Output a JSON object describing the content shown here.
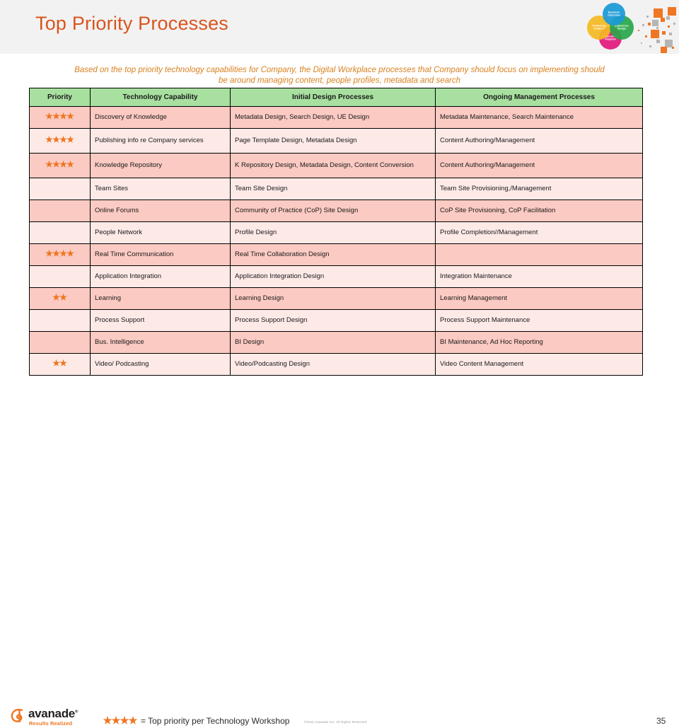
{
  "slide": {
    "title": "Top Priority Processes",
    "page_number": "35",
    "subtitle": "Based on the top priority technology capabilities for Company, the Digital Workplace processes that Company should focus on implementing should be around managing content, people profiles, metadata and search"
  },
  "corner_logo": {
    "name": "four-circle-venn-logo",
    "circles": [
      {
        "label": "Business\nOutcomes",
        "color": "#1a9ad7"
      },
      {
        "label": "Technology\nEnablers",
        "color": "#f5ba23"
      },
      {
        "label": "Experience\nDesign",
        "color": "#2aa84a"
      },
      {
        "label": "Organisation\nAdoption",
        "color": "#e2197c"
      }
    ],
    "accent_square_color": "#ef7622",
    "muted_square_color": "#b5b5b5"
  },
  "table": {
    "headers": [
      "Priority",
      "Technology Capability",
      "Initial Design Processes",
      "Ongoing Management Processes"
    ],
    "header_bg": "#a8e0a0",
    "row_bg_dark": "#fbcac2",
    "row_bg_light": "#fdeae7",
    "star_color": "#ef7622",
    "rows": [
      {
        "stars": 4,
        "capability": "Discovery of Knowledge",
        "initial": "Metadata Design, Search Design, UE Design",
        "ongoing": "Metadata Maintenance, Search Maintenance"
      },
      {
        "stars": 4,
        "capability": "Publishing info re Company services",
        "initial": "Page Template Design, Metadata Design",
        "ongoing": "Content Authoring/Management"
      },
      {
        "stars": 4,
        "capability": "Knowledge Repository",
        "initial": "K Repository Design, Metadata Design, Content Conversion",
        "ongoing": "Content Authoring/Management"
      },
      {
        "stars": 0,
        "capability": "Team Sites",
        "initial": "Team Site Design",
        "ongoing": "Team Site Provisioning,/Management"
      },
      {
        "stars": 0,
        "capability": "Online Forums",
        "initial": "Community of Practice (CoP) Site Design",
        "ongoing": "CoP Site Provisioning, CoP Facilitation"
      },
      {
        "stars": 0,
        "capability": "People Network",
        "initial": "Profile Design",
        "ongoing": "Profile Completion//Management"
      },
      {
        "stars": 4,
        "capability": "Real Time Communication",
        "initial": "Real Time Collaboration Design",
        "ongoing": ""
      },
      {
        "stars": 0,
        "capability": "Application Integration",
        "initial": "Application Integration Design",
        "ongoing": "Integration Maintenance"
      },
      {
        "stars": 2,
        "capability": "Learning",
        "initial": "Learning Design",
        "ongoing": "Learning Management"
      },
      {
        "stars": 0,
        "capability": "Process Support",
        "initial": "Process Support Design",
        "ongoing": "Process Support Maintenance"
      },
      {
        "stars": 0,
        "capability": "Bus. Intelligence",
        "initial": "BI Design",
        "ongoing": "BI Maintenance, Ad Hoc Reporting"
      },
      {
        "stars": 2,
        "capability": "Video/ Podcasting",
        "initial": "Video/Podcasting Design",
        "ongoing": "Video Content Management"
      }
    ]
  },
  "footer": {
    "brand_name": "avanade",
    "brand_tm": "®",
    "brand_tagline": "Results Realized",
    "legend_stars": 4,
    "legend_text": "= Top priority per Technology Workshop",
    "copyright": "©2011 Avanade Inc. All Rights Reserved"
  }
}
